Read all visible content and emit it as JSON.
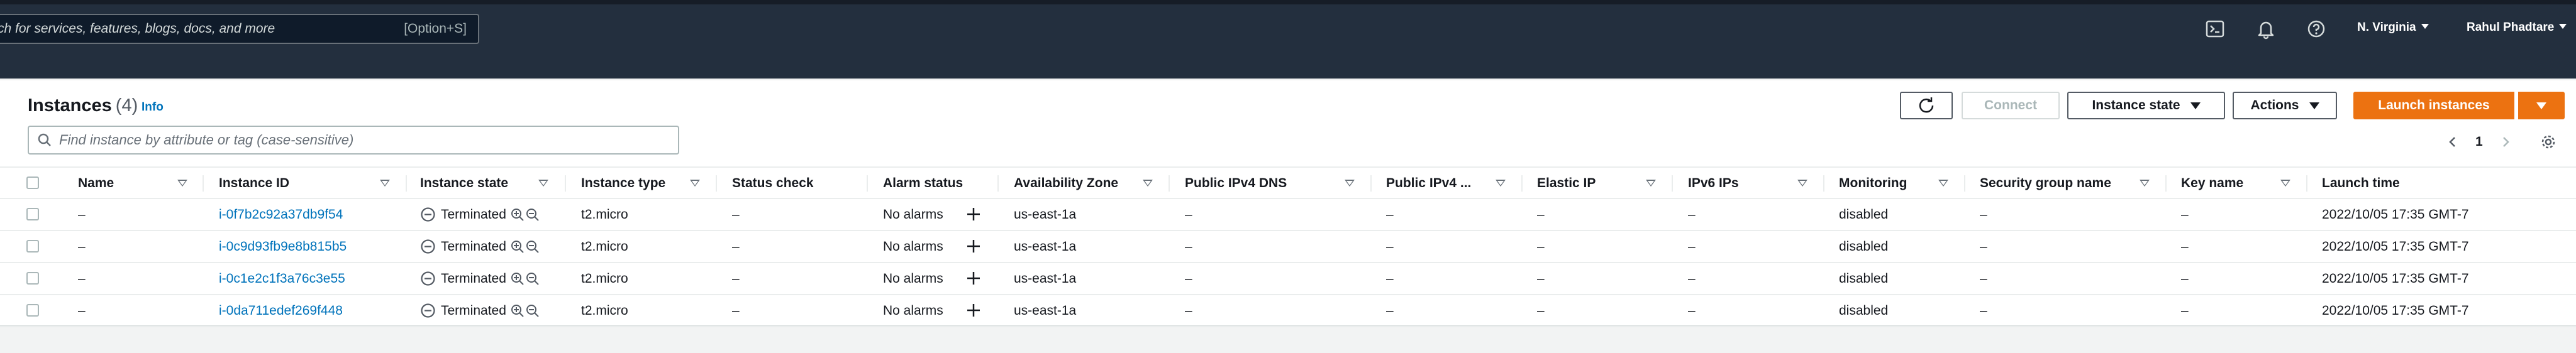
{
  "topnav": {
    "search_placeholder": "ch for services, features, blogs, docs, and more",
    "search_shortcut": "[Option+S]",
    "region": "N. Virginia",
    "user": "Rahul Phadtare"
  },
  "panel": {
    "title": "Instances",
    "count": "(4)",
    "info": "Info",
    "filter_placeholder": "Find instance by attribute or tag (case-sensitive)",
    "buttons": {
      "connect": "Connect",
      "instance_state": "Instance state",
      "actions": "Actions",
      "launch": "Launch instances"
    },
    "page_number": "1"
  },
  "table": {
    "columns": [
      "Name",
      "Instance ID",
      "Instance state",
      "Instance type",
      "Status check",
      "Alarm status",
      "Availability Zone",
      "Public IPv4 DNS",
      "Public IPv4 ...",
      "Elastic IP",
      "IPv6 IPs",
      "Monitoring",
      "Security group name",
      "Key name",
      "Launch time"
    ],
    "rows": [
      {
        "name": "–",
        "instance_id": "i-0f7b2c92a37db9f54",
        "state": "Terminated",
        "type": "t2.micro",
        "status_check": "–",
        "alarm": "No alarms",
        "az": "us-east-1a",
        "dns": "–",
        "ipv4": "–",
        "eip": "–",
        "ipv6": "–",
        "monitoring": "disabled",
        "sg": "–",
        "key": "–",
        "launch": "2022/10/05 17:35 GMT-7"
      },
      {
        "name": "–",
        "instance_id": "i-0c9d93fb9e8b815b5",
        "state": "Terminated",
        "type": "t2.micro",
        "status_check": "–",
        "alarm": "No alarms",
        "az": "us-east-1a",
        "dns": "–",
        "ipv4": "–",
        "eip": "–",
        "ipv6": "–",
        "monitoring": "disabled",
        "sg": "–",
        "key": "–",
        "launch": "2022/10/05 17:35 GMT-7"
      },
      {
        "name": "–",
        "instance_id": "i-0c1e2c1f3a76c3e55",
        "state": "Terminated",
        "type": "t2.micro",
        "status_check": "–",
        "alarm": "No alarms",
        "az": "us-east-1a",
        "dns": "–",
        "ipv4": "–",
        "eip": "–",
        "ipv6": "–",
        "monitoring": "disabled",
        "sg": "–",
        "key": "–",
        "launch": "2022/10/05 17:35 GMT-7"
      },
      {
        "name": "–",
        "instance_id": "i-0da711edef269f448",
        "state": "Terminated",
        "type": "t2.micro",
        "status_check": "–",
        "alarm": "No alarms",
        "az": "us-east-1a",
        "dns": "–",
        "ipv4": "–",
        "eip": "–",
        "ipv6": "–",
        "monitoring": "disabled",
        "sg": "–",
        "key": "–",
        "launch": "2022/10/05 17:35 GMT-7"
      }
    ]
  },
  "colors": {
    "nav_bg": "#232f3e",
    "link": "#0073bb",
    "primary": "#ec7211"
  }
}
